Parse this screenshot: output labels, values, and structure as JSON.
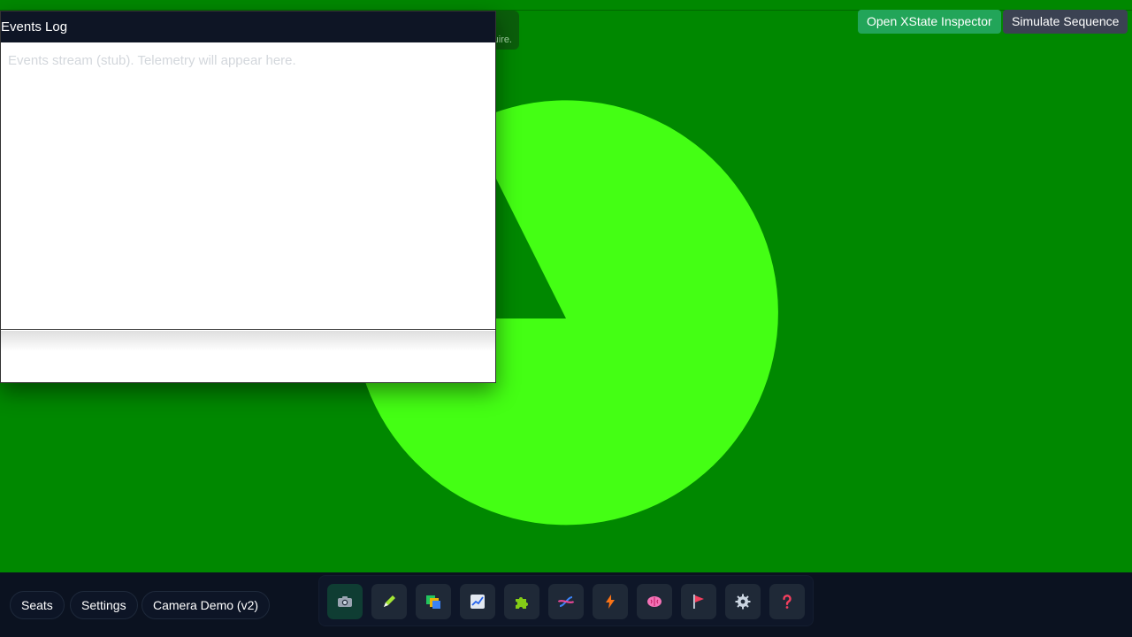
{
  "header": {
    "buttons": {
      "inspector_label": "Open XState Inspector",
      "simulate_label": "Simulate Sequence"
    },
    "hidden_card_text": "uire."
  },
  "events_log": {
    "title": "Events Log",
    "placeholder": "Events stream (stub). Telemetry will appear here."
  },
  "bottom_bar": {
    "pills": {
      "seats": "Seats",
      "settings": "Settings",
      "camera": "Camera Demo (v2)"
    },
    "tools": [
      {
        "name": "camera-icon",
        "active": true
      },
      {
        "name": "pencil-icon",
        "active": false
      },
      {
        "name": "layers-icon",
        "active": false
      },
      {
        "name": "chart-icon",
        "active": false
      },
      {
        "name": "puzzle-icon",
        "active": false
      },
      {
        "name": "dna-icon",
        "active": false
      },
      {
        "name": "lightning-icon",
        "active": false
      },
      {
        "name": "brain-icon",
        "active": false
      },
      {
        "name": "flag-icon",
        "active": false
      },
      {
        "name": "gear-icon",
        "active": false
      },
      {
        "name": "help-icon",
        "active": false
      }
    ]
  },
  "colors": {
    "background": "#008800",
    "pie": "#44ff14",
    "bottom_bar": "#0b1220",
    "inspector_button": "#22a559",
    "simulate_button": "#3b4252"
  }
}
